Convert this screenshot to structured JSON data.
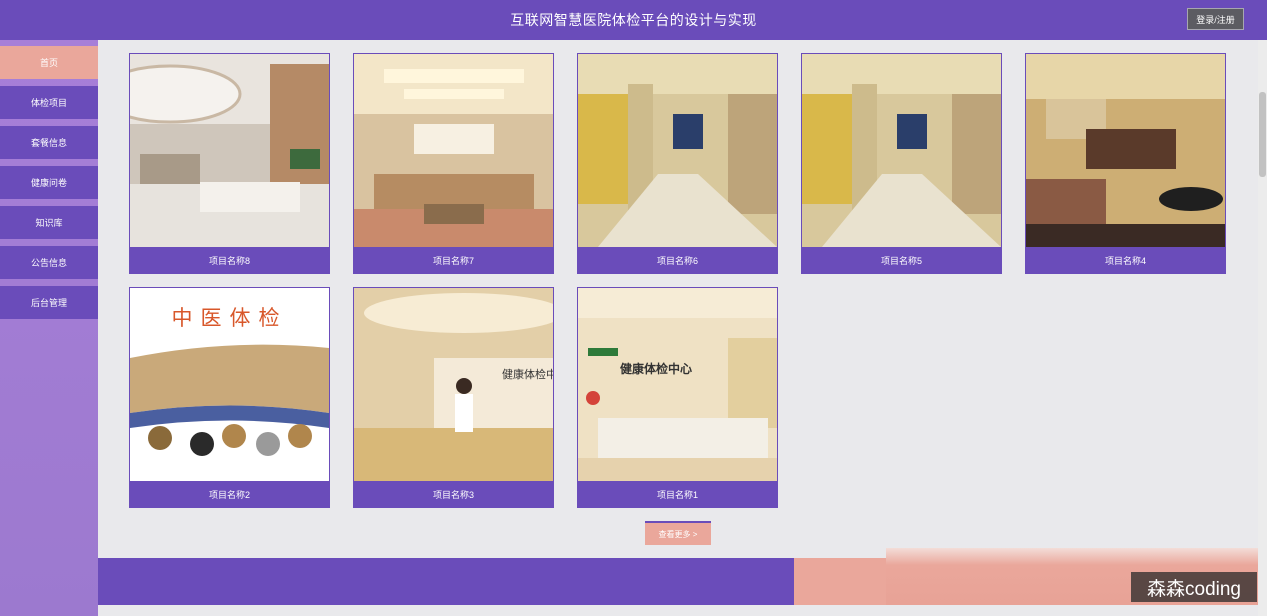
{
  "header": {
    "title": "互联网智慧医院体检平台的设计与实现",
    "login_label": "登录/注册"
  },
  "sidebar": {
    "items": [
      {
        "label": "首页",
        "active": true
      },
      {
        "label": "体检项目",
        "active": false
      },
      {
        "label": "套餐信息",
        "active": false
      },
      {
        "label": "健康问卷",
        "active": false
      },
      {
        "label": "知识库",
        "active": false
      },
      {
        "label": "公告信息",
        "active": false
      },
      {
        "label": "后台管理",
        "active": false
      }
    ]
  },
  "cards": [
    {
      "label": "项目名称8",
      "image": "hospital-lobby-photo"
    },
    {
      "label": "项目名称7",
      "image": "waiting-room-photo"
    },
    {
      "label": "项目名称6",
      "image": "hallway-photo"
    },
    {
      "label": "项目名称5",
      "image": "hallway-photo"
    },
    {
      "label": "项目名称4",
      "image": "reception-photo"
    },
    {
      "label": "项目名称2",
      "image": "tcm-checkup-poster"
    },
    {
      "label": "项目名称3",
      "image": "reception-desk-photo"
    },
    {
      "label": "项目名称1",
      "image": "health-center-photo"
    }
  ],
  "more_label": "查看更多 >",
  "poster_text": "中医体检",
  "photo_sign_text": "健康体检中心",
  "watermark": "森森coding",
  "colors": {
    "primary": "#6a4cba",
    "accent": "#eaa79b",
    "sidebar": "#a77fd8"
  }
}
